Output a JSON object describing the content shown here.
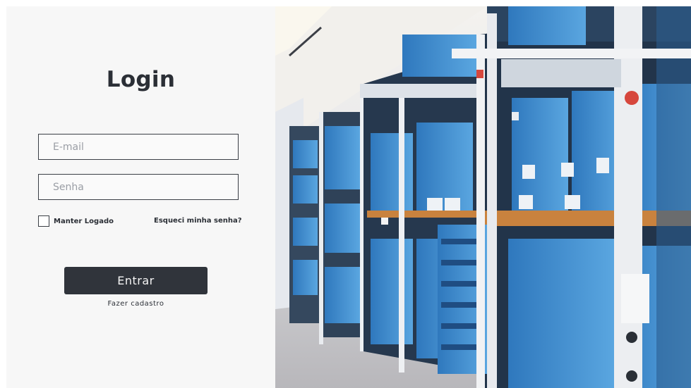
{
  "login": {
    "title": "Login",
    "email_placeholder": "E-mail",
    "password_placeholder": "Senha",
    "remember_label": "Manter Logado",
    "forgot_label": "Esqueci minha senha?",
    "submit_label": "Entrar",
    "register_label": "Fazer cadastro"
  },
  "colors": {
    "button": "#30343b",
    "panel_background": "#f7f7f7",
    "text": "#2b2f36",
    "shelf_blue": "#3f8ed0",
    "shelf_wood": "#c9823e"
  },
  "image": {
    "icon": "archive-shelves-illustration"
  }
}
